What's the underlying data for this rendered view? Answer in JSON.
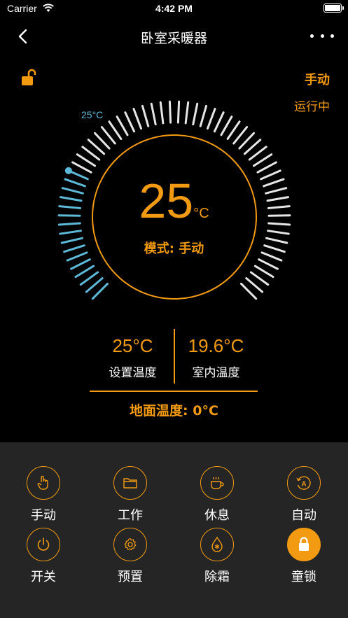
{
  "status": {
    "carrier": "Carrier",
    "time": "4:42 PM"
  },
  "nav": {
    "title": "卧室采暖器"
  },
  "top": {
    "mode": "手动",
    "state": "运行中"
  },
  "dial": {
    "set_point_label": "25°C",
    "temperature": "25",
    "unit": "°C",
    "mode_text": "模式: 手动",
    "set_point": 25,
    "min_temp": 5,
    "max_temp": 85
  },
  "readings": {
    "set_temp_value": "25°C",
    "set_temp_label": "设置温度",
    "room_temp_value": "19.6°C",
    "room_temp_label": "室内温度"
  },
  "floor_temp": "地面温度: 0°C",
  "buttons": [
    {
      "label": "手动",
      "icon": "hand-pointer-icon"
    },
    {
      "label": "工作",
      "icon": "folder-icon"
    },
    {
      "label": "休息",
      "icon": "coffee-cup-icon"
    },
    {
      "label": "自动",
      "icon": "auto-icon"
    },
    {
      "label": "开关",
      "icon": "power-icon"
    },
    {
      "label": "预置",
      "icon": "gear-icon"
    },
    {
      "label": "除霜",
      "icon": "defrost-drop-icon"
    },
    {
      "label": "童锁",
      "icon": "lock-icon"
    }
  ],
  "colors": {
    "accent": "#f29a12",
    "active_tick": "#5db9d8",
    "inactive_tick": "#e6e6e6",
    "panel": "#252525"
  }
}
